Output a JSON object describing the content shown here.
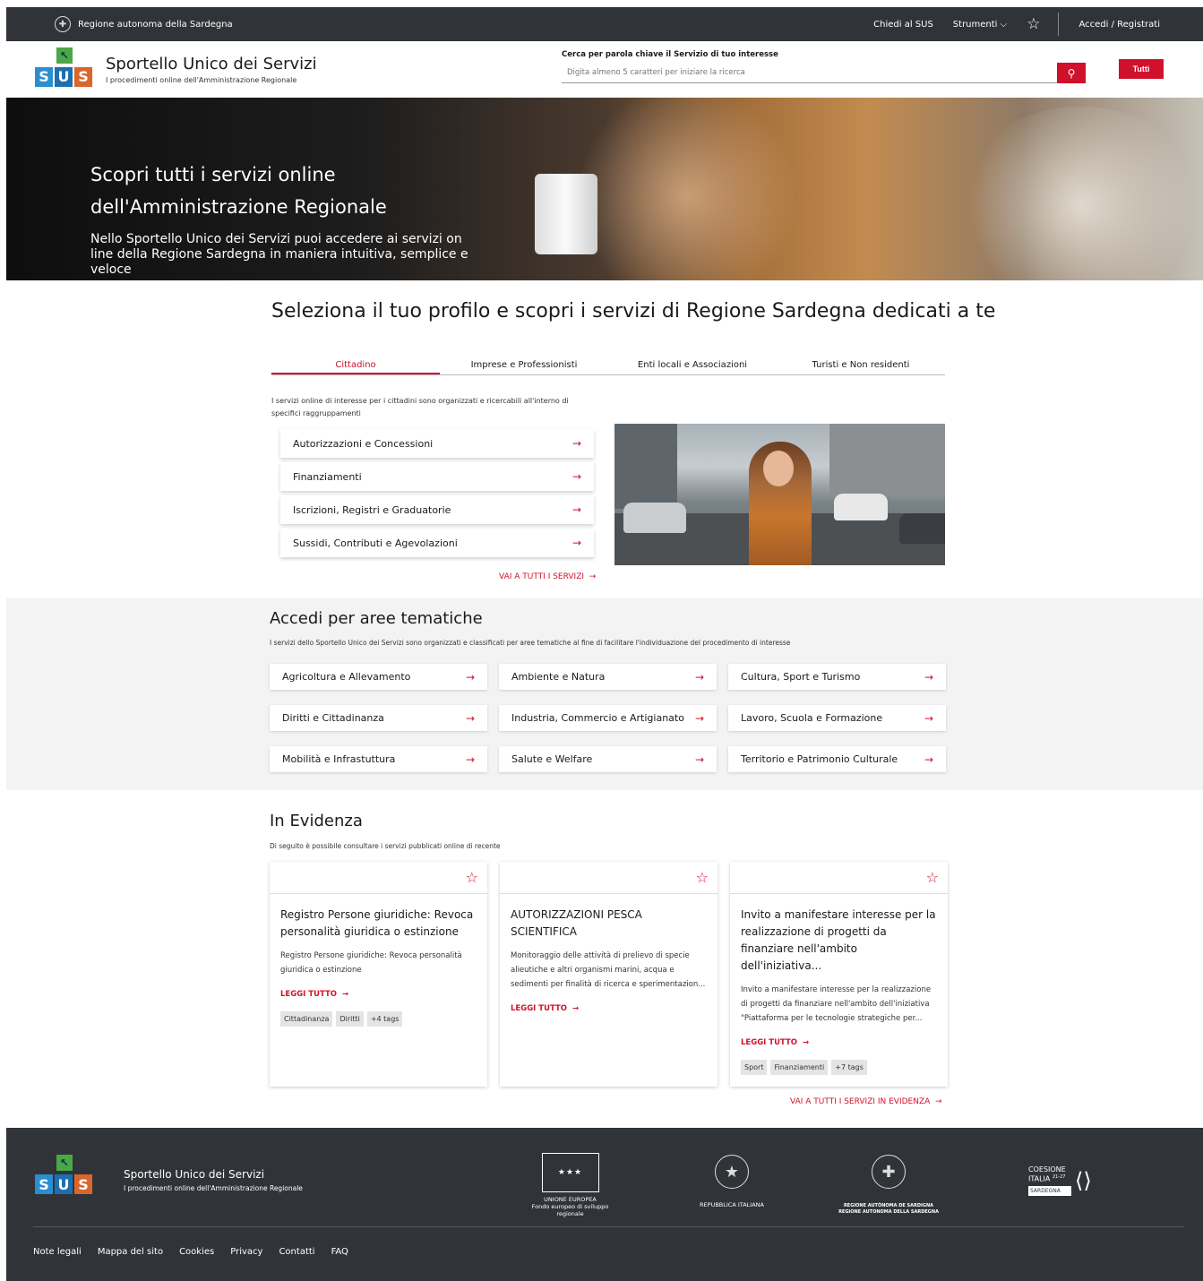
{
  "topbar": {
    "region": "Regione autonoma della Sardegna",
    "chiedi": "Chiedi al SUS",
    "strumenti": "Strumenti",
    "login": "Accedi / Registrati"
  },
  "header": {
    "logo_letters": [
      "S",
      "U",
      "S"
    ],
    "title": "Sportello Unico dei Servizi",
    "subtitle": "I procedimenti online dell'Amministrazione Regionale",
    "search_label": "Cerca per parola chiave il Servizio di tuo interesse",
    "search_placeholder": "Digita almeno 5 caratteri per iniziare la ricerca",
    "all_button": "Tutti"
  },
  "hero": {
    "title": "Scopri tutti i servizi online dell'Amministrazione Regionale",
    "text": "Nello Sportello Unico dei Servizi puoi accedere ai servizi on line della Regione Sardegna in maniera intuitiva, semplice e veloce"
  },
  "profile": {
    "title": "Seleziona il tuo profilo e scopri i servizi di Regione Sardegna dedicati a te",
    "tabs": [
      "Cittadino",
      "Imprese e Professionisti",
      "Enti locali e Associazioni",
      "Turisti e Non residenti"
    ],
    "description": "I servizi online di interesse per i cittadini sono organizzati e ricercabili all'interno di specifici raggruppamenti",
    "items": [
      "Autorizzazioni e Concessioni",
      "Finanziamenti",
      "Iscrizioni, Registri e Graduatorie",
      "Sussidi, Contributi e Agevolazioni"
    ],
    "all_link": "VAI A TUTTI I SERVIZI"
  },
  "areas": {
    "title": "Accedi per aree tematiche",
    "description": "I servizi dello Sportello Unico dei Servizi sono organizzati e classificati per aree tematiche al fine di facilitare l'individuazione del procedimento di interesse",
    "items": [
      "Agricoltura e Allevamento",
      "Ambiente e Natura",
      "Cultura, Sport e Turismo",
      "Diritti e Cittadinanza",
      "Industria, Commercio e Artigianato",
      "Lavoro, Scuola e Formazione",
      "Mobilità e Infrastuttura",
      "Salute e Welfare",
      "Territorio e Patrimonio Culturale"
    ]
  },
  "evidenza": {
    "title": "In Evidenza",
    "description": "Di seguito è possibile consultare i servizi pubblicati online di recente",
    "read_more": "LEGGI TUTTO",
    "cards": [
      {
        "title": "Registro Persone giuridiche: Revoca personalità giuridica o estinzione",
        "text": "Registro Persone giuridiche: Revoca personalità giuridica o estinzione",
        "tags": [
          "Cittadinanza",
          "Diritti",
          "+4 tags"
        ]
      },
      {
        "title": "AUTORIZZAZIONI PESCA SCIENTIFICA",
        "text": "Monitoraggio delle attività di prelievo di specie alieutiche e altri organismi marini, acqua e sedimenti per finalità di ricerca e sperimentazion...",
        "tags": []
      },
      {
        "title": "Invito a manifestare interesse per la realizzazione di progetti da finanziare nell'ambito dell'iniziativa...",
        "text": "Invito a manifestare interesse per la realizzazione di progetti da finanziare nell'ambito dell'iniziativa \"Piattaforma per le tecnologie strategiche per...",
        "tags": [
          "Sport",
          "Finanziamenti",
          "+7 tags"
        ]
      }
    ],
    "all_link": "VAI A TUTTI I SERVIZI IN EVIDENZA"
  },
  "footer": {
    "title": "Sportello Unico dei Servizi",
    "subtitle": "I procedimenti online dell'Amministrazione Regionale",
    "eu_line1": "UNIONE EUROPEA",
    "eu_line2": "Fondo europeo di sviluppo regionale",
    "republic": "REPUBBLICA ITALIANA",
    "ras_line1": "REGIONE AUTÒNOMA DE SARDIGNA",
    "ras_line2": "REGIONE AUTONOMA DELLA SARDEGNA",
    "coesione_line1": "COESIONE",
    "coesione_line2": "ITALIA",
    "coesione_years": "21-27",
    "coesione_region": "SARDEGNA",
    "links": [
      "Note legali",
      "Mappa del sito",
      "Cookies",
      "Privacy",
      "Contatti",
      "FAQ"
    ]
  },
  "colors": {
    "accent": "#d0112b",
    "dark": "#303438",
    "band": "#f3f3f3"
  },
  "icons": {
    "arrow": "→",
    "star": "☆",
    "search": "⚲",
    "chevron": "⌵"
  }
}
